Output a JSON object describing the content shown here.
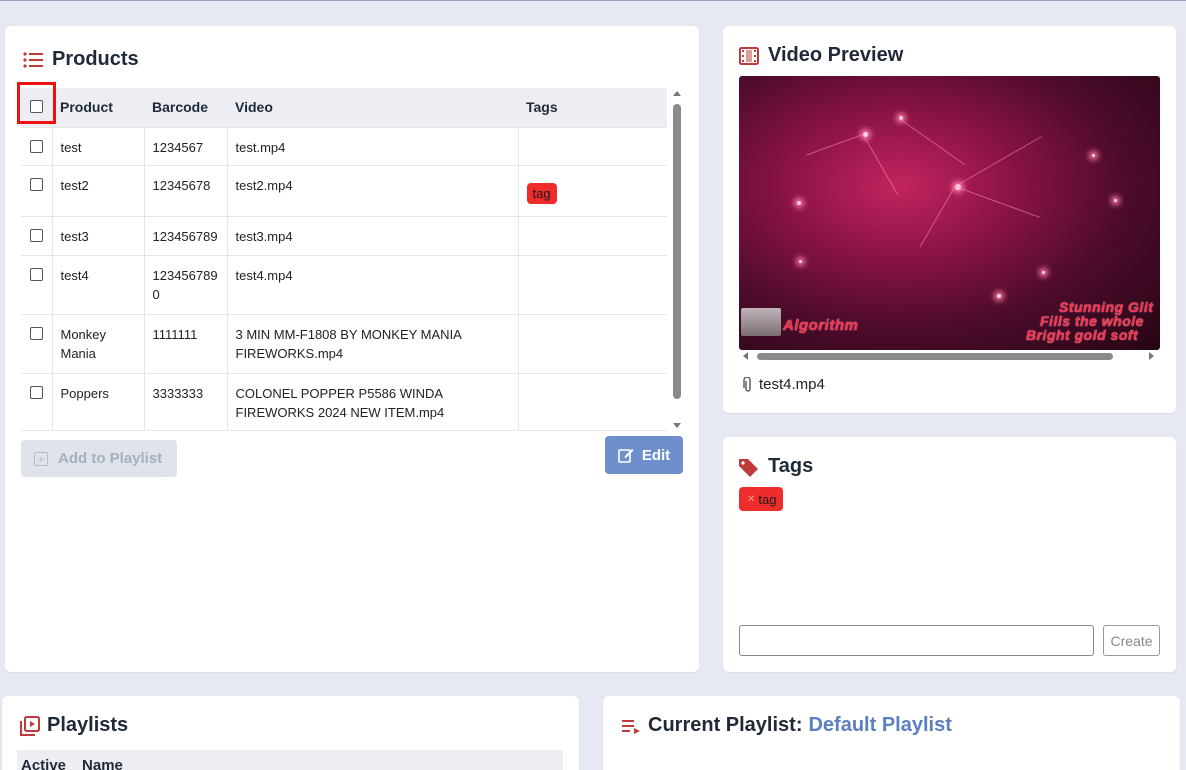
{
  "products": {
    "title": "Products",
    "columns": [
      "Product",
      "Barcode",
      "Video",
      "Tags"
    ],
    "rows": [
      {
        "product": "test",
        "barcode": "1234567",
        "video": "test.mp4",
        "tag": ""
      },
      {
        "product": "test2",
        "barcode": "12345678",
        "video": "test2.mp4",
        "tag": "tag"
      },
      {
        "product": "test3",
        "barcode": "123456789",
        "video": "test3.mp4",
        "tag": ""
      },
      {
        "product": "test4",
        "barcode": "1234567890",
        "video": "test4.mp4",
        "tag": ""
      },
      {
        "product": "Monkey Mania",
        "barcode": "1111111",
        "video": "3 MIN MM-F1808 BY MONKEY MANIA FIREWORKS.mp4",
        "tag": ""
      },
      {
        "product": "Poppers",
        "barcode": "3333333",
        "video": "COLONEL POPPER P5586 WINDA FIREWORKS 2024 NEW ITEM.mp4",
        "tag": ""
      }
    ],
    "add_button": "Add to Playlist",
    "edit_button": "Edit"
  },
  "video_preview": {
    "title": "Video Preview",
    "overlay_left": "Algorithm",
    "overlay_right_lines": [
      "Stunning Glit",
      "Fills the whole",
      "Bright gold soft"
    ],
    "filename": "test4.mp4"
  },
  "tags": {
    "title": "Tags",
    "chips": [
      "tag"
    ],
    "input_value": "",
    "create_button": "Create"
  },
  "playlists": {
    "title": "Playlists",
    "columns": [
      "Active",
      "Name"
    ]
  },
  "current_playlist": {
    "label": "Current Playlist:",
    "name": "Default Playlist"
  },
  "colors": {
    "accent": "#5b7fc0",
    "icon_red": "#c0393b",
    "tag_red": "#ef2c2c",
    "edit_button": "#6e8fcc"
  }
}
